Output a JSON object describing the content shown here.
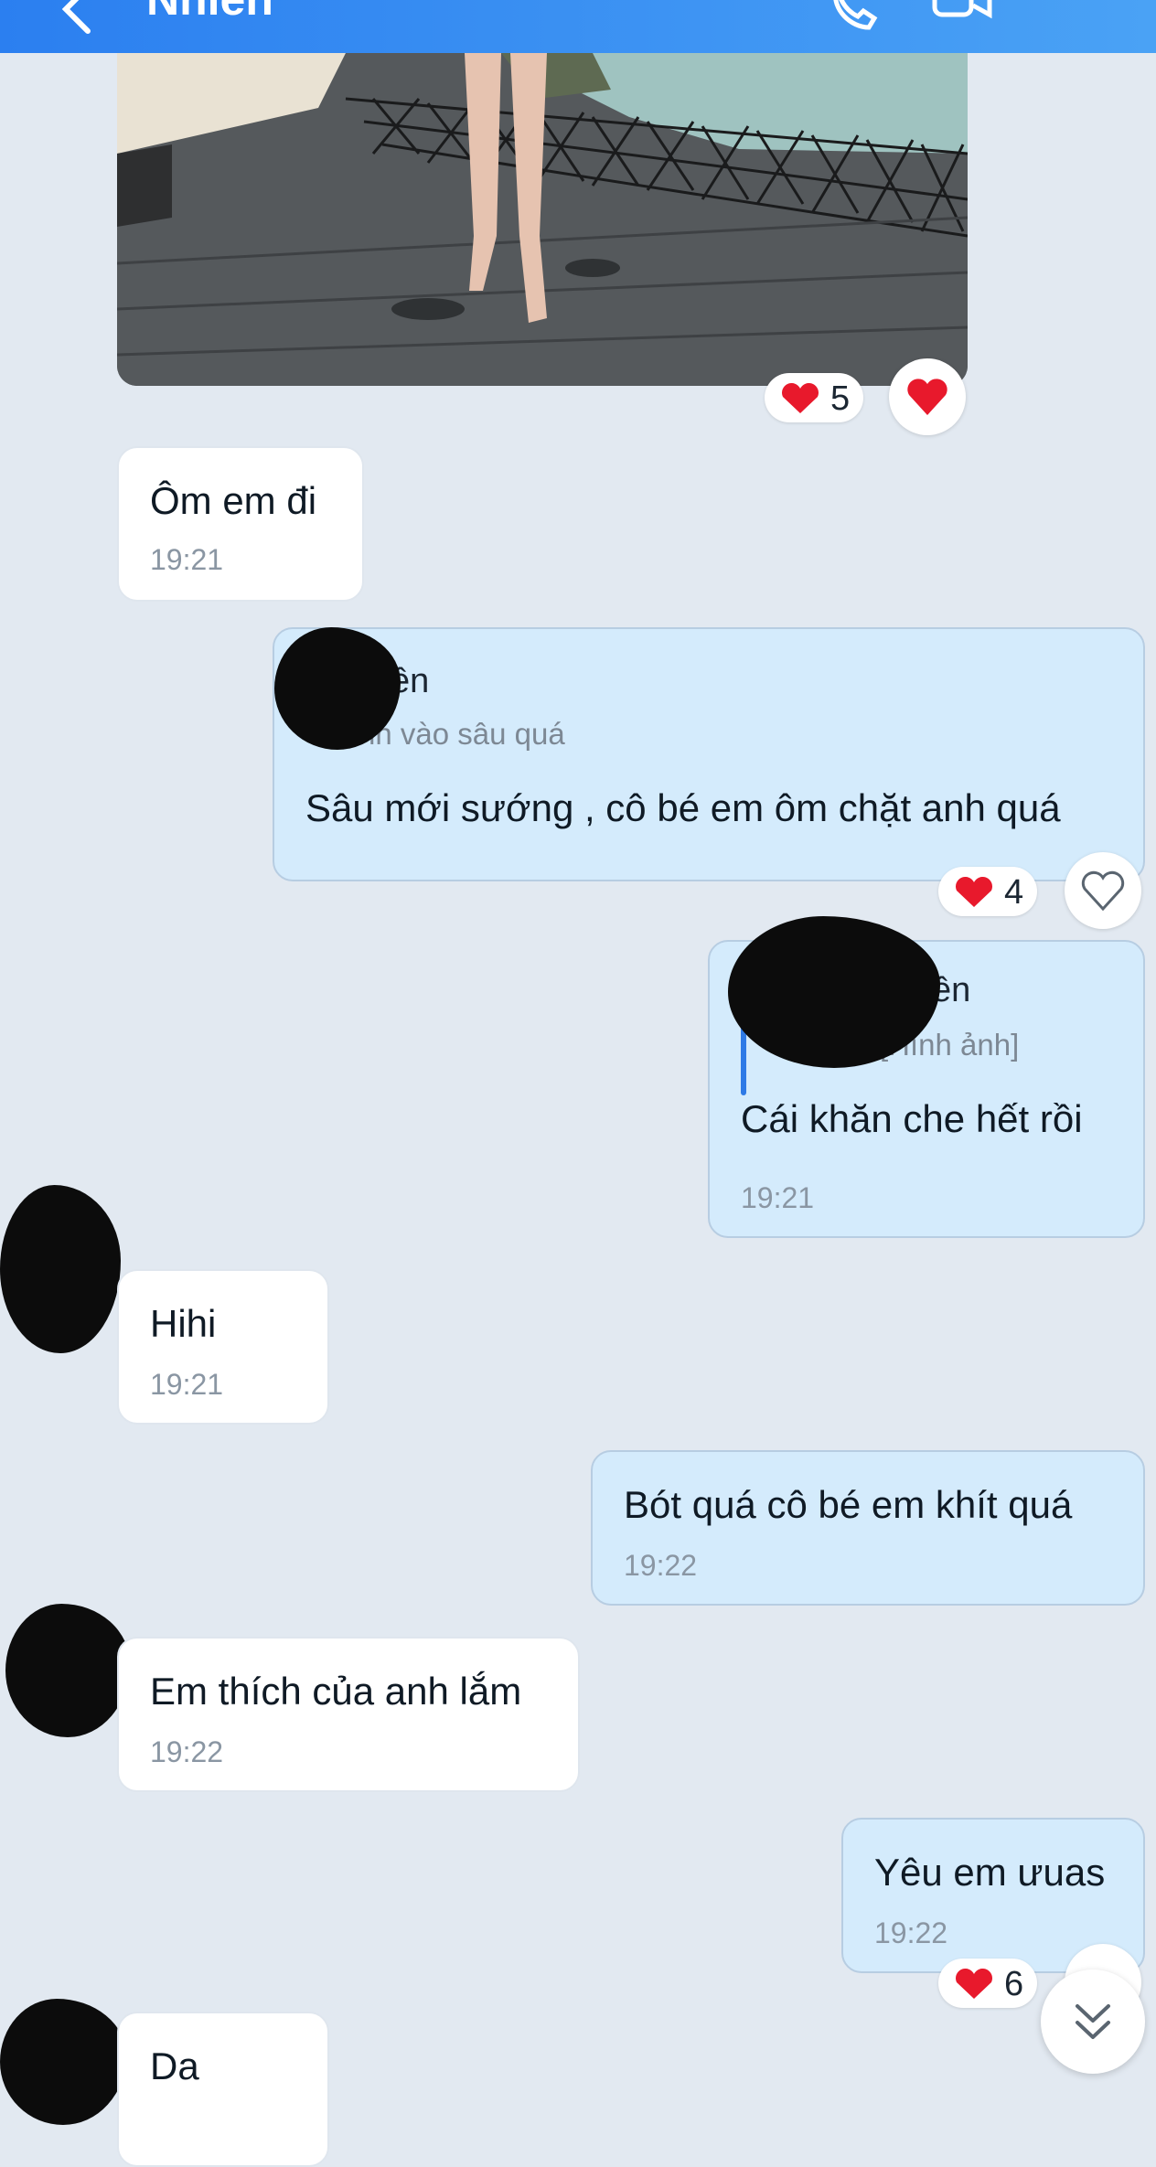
{
  "header": {
    "title": "Nhiên",
    "icons": [
      "back-arrow-icon",
      "phone-icon",
      "video-call-icon",
      "menu-icon"
    ]
  },
  "messages": [
    {
      "id": "m0",
      "direction": "received",
      "type": "image",
      "reaction_icon": "heart",
      "reaction_count": "5"
    },
    {
      "id": "m1",
      "direction": "received",
      "text": "Ôm em đi",
      "time": "19:21"
    },
    {
      "id": "m2",
      "direction": "sent",
      "quote_name": "Nhiên",
      "quote_text": "Anh vào sâu quá",
      "text": "Sâu mới sướng , cô bé em ôm chặt anh quá",
      "reaction_icon": "heart",
      "reaction_count": "4"
    },
    {
      "id": "m3",
      "direction": "sent",
      "quote_name": "Nhiên",
      "quote_text": "[Hình ảnh]",
      "text": "Cái khăn che hết rồi",
      "time": "19:21"
    },
    {
      "id": "m4",
      "direction": "received",
      "text": "Hihi",
      "time": "19:21"
    },
    {
      "id": "m5",
      "direction": "sent",
      "text": "Bót quá cô bé em khít quá",
      "time": "19:22"
    },
    {
      "id": "m6",
      "direction": "received",
      "text": "Em thích của anh lắm",
      "time": "19:22"
    },
    {
      "id": "m7",
      "direction": "sent",
      "text": "Yêu em ưuas",
      "time": "19:22",
      "reaction_icon": "heart",
      "reaction_count": "6"
    },
    {
      "id": "m8",
      "direction": "received",
      "text": "Da"
    }
  ],
  "colors": {
    "header": "#3b8ff2",
    "background": "#e2e9f1",
    "sent_bubble": "#d4ebfc",
    "received_bubble": "#ffffff",
    "heart": "#e8192c",
    "quote_bar": "#2e7ae6"
  },
  "scroll_button": {
    "icon": "double-chevron-down-icon"
  }
}
